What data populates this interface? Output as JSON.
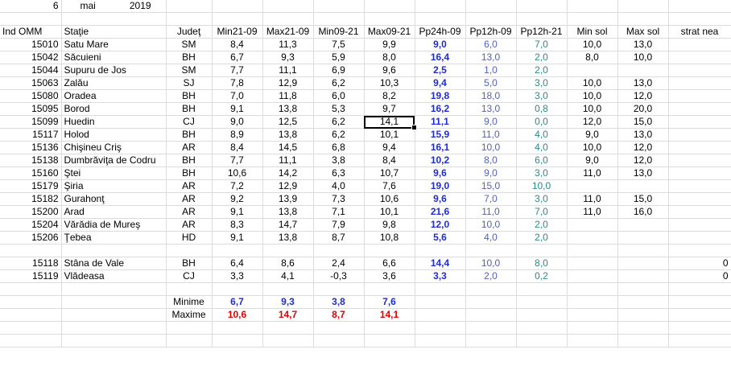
{
  "date": {
    "day": "6",
    "month": "mai",
    "year": "2019"
  },
  "headers": [
    "Ind OMM",
    "Staţie",
    "Judeţ",
    "Min21-09",
    "Max21-09",
    "Min09-21",
    "Max09-21",
    "Pp24h-09",
    "Pp12h-09",
    "Pp12h-21",
    "Min sol",
    "Max sol",
    "strat nea"
  ],
  "rows": [
    [
      "15010",
      "Satu Mare",
      "SM",
      "8,4",
      "11,3",
      "7,5",
      "9,9",
      "9,0",
      "6,0",
      "7,0",
      "10,0",
      "13,0",
      ""
    ],
    [
      "15042",
      "Săcuieni",
      "BH",
      "6,7",
      "9,3",
      "5,9",
      "8,0",
      "16,4",
      "13,0",
      "2,0",
      "8,0",
      "10,0",
      ""
    ],
    [
      "15044",
      "Supuru de Jos",
      "SM",
      "7,7",
      "11,1",
      "6,9",
      "9,6",
      "2,5",
      "1,0",
      "2,0",
      "",
      "",
      ""
    ],
    [
      "15063",
      "Zalău",
      "SJ",
      "7,8",
      "12,9",
      "6,2",
      "10,3",
      "9,4",
      "5,0",
      "3,0",
      "10,0",
      "13,0",
      ""
    ],
    [
      "15080",
      "Oradea",
      "BH",
      "7,0",
      "11,8",
      "6,0",
      "8,2",
      "19,8",
      "18,0",
      "3,0",
      "10,0",
      "12,0",
      ""
    ],
    [
      "15095",
      "Borod",
      "BH",
      "9,1",
      "13,8",
      "5,3",
      "9,7",
      "16,2",
      "13,0",
      "0,8",
      "10,0",
      "20,0",
      ""
    ],
    [
      "15099",
      "Huedin",
      "CJ",
      "9,0",
      "12,5",
      "6,2",
      "14,1",
      "11,1",
      "9,0",
      "0,0",
      "12,0",
      "15,0",
      ""
    ],
    [
      "15117",
      "Holod",
      "BH",
      "8,9",
      "13,8",
      "6,2",
      "10,1",
      "15,9",
      "11,0",
      "4,0",
      "9,0",
      "13,0",
      ""
    ],
    [
      "15136",
      "Chişineu    Criş",
      "AR",
      "8,4",
      "14,5",
      "6,8",
      "9,4",
      "16,1",
      "10,0",
      "4,0",
      "10,0",
      "12,0",
      ""
    ],
    [
      "15138",
      "Dumbrăviţa  de Codru",
      "BH",
      "7,7",
      "11,1",
      "3,8",
      "8,4",
      "10,2",
      "8,0",
      "6,0",
      "9,0",
      "12,0",
      ""
    ],
    [
      "15160",
      "Ştei",
      "BH",
      "10,6",
      "14,2",
      "6,3",
      "10,7",
      "9,6",
      "9,0",
      "3,0",
      "11,0",
      "13,0",
      ""
    ],
    [
      "15179",
      "Şiria",
      "AR",
      "7,2",
      "12,9",
      "4,0",
      "7,6",
      "19,0",
      "15,0",
      "10,0",
      "",
      "",
      ""
    ],
    [
      "15182",
      "Gurahonţ",
      "AR",
      "9,2",
      "13,9",
      "7,3",
      "10,6",
      "9,6",
      "7,0",
      "3,0",
      "11,0",
      "15,0",
      ""
    ],
    [
      "15200",
      "Arad",
      "AR",
      "9,1",
      "13,8",
      "7,1",
      "10,1",
      "21,6",
      "11,0",
      "7,0",
      "11,0",
      "16,0",
      ""
    ],
    [
      "15204",
      "Vărădia de Mureş",
      "AR",
      "8,3",
      "14,7",
      "7,9",
      "9,8",
      "12,0",
      "10,0",
      "2,0",
      "",
      "",
      ""
    ],
    [
      "15206",
      "Ţebea",
      "HD",
      "9,1",
      "13,8",
      "8,7",
      "10,8",
      "5,6",
      "4,0",
      "2,0",
      "",
      "",
      ""
    ]
  ],
  "mountain_rows": [
    [
      "15118",
      "Stâna de Vale",
      "BH",
      "6,4",
      "8,6",
      "2,4",
      "6,6",
      "14,4",
      "10,0",
      "8,0",
      "",
      "",
      "0"
    ],
    [
      "15119",
      "Vlădeasa",
      "CJ",
      "3,3",
      "4,1",
      "-0,3",
      "3,6",
      "3,3",
      "2,0",
      "0,2",
      "",
      "",
      "0"
    ]
  ],
  "summary": {
    "min_label": "Minime",
    "max_label": "Maxime",
    "min_values": [
      "6,7",
      "9,3",
      "3,8",
      "7,6"
    ],
    "max_values": [
      "10,6",
      "14,7",
      "8,7",
      "14,1"
    ]
  },
  "colors": {
    "pp24": "#1f2bd6",
    "pp12": "#5560b8",
    "pp21": "#2a8a8a",
    "min": "#1f2bd6",
    "max": "#e00000",
    "grid": "#dcdcdc"
  },
  "selected_cell": {
    "row": 6,
    "col": 6
  }
}
